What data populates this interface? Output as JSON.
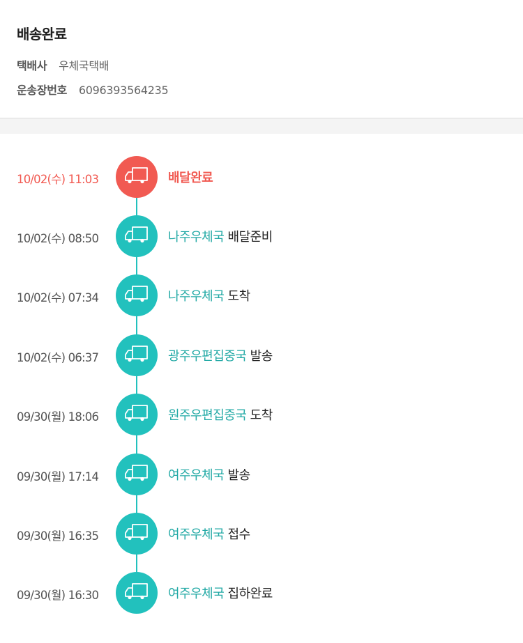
{
  "header": {
    "status": "배송완료",
    "courier_label": "택배사",
    "courier_value": "우체국택배",
    "tracking_label": "운송장번호",
    "tracking_value": "6096393564235"
  },
  "colors": {
    "accent": "#22c1bd",
    "active": "#f15a52"
  },
  "events": [
    {
      "time": "10/02(수) 11:03",
      "place": "",
      "action": "배달완료",
      "icon": "truck-icon",
      "active": true
    },
    {
      "time": "10/02(수) 08:50",
      "place": "나주우체국",
      "action": "배달준비",
      "icon": "truck-icon",
      "active": false
    },
    {
      "time": "10/02(수) 07:34",
      "place": "나주우체국",
      "action": "도착",
      "icon": "truck-icon",
      "active": false
    },
    {
      "time": "10/02(수) 06:37",
      "place": "광주우편집중국",
      "action": "발송",
      "icon": "truck-icon",
      "active": false
    },
    {
      "time": "09/30(월) 18:06",
      "place": "원주우편집중국",
      "action": "도착",
      "icon": "truck-icon",
      "active": false
    },
    {
      "time": "09/30(월) 17:14",
      "place": "여주우체국",
      "action": "발송",
      "icon": "truck-icon",
      "active": false
    },
    {
      "time": "09/30(월) 16:35",
      "place": "여주우체국",
      "action": "접수",
      "icon": "truck-icon",
      "active": false
    },
    {
      "time": "09/30(월) 16:30",
      "place": "여주우체국",
      "action": "집하완료",
      "icon": "truck-icon",
      "active": false
    }
  ]
}
